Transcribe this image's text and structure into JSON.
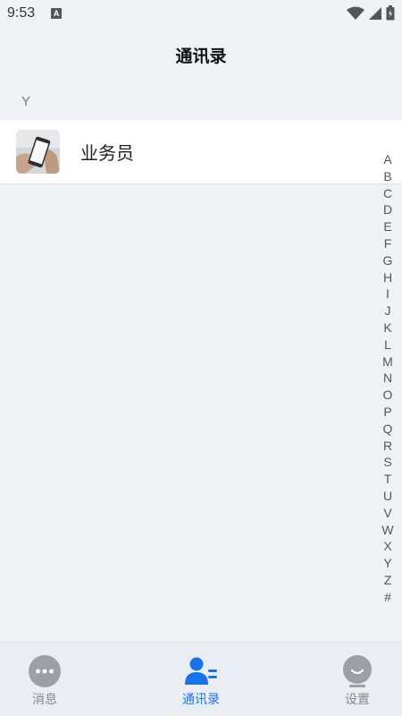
{
  "status_bar": {
    "time": "9:53",
    "notification_badge": "A"
  },
  "header": {
    "title": "通讯录"
  },
  "contacts": {
    "section_letter": "Y",
    "items": [
      {
        "name": "业务员",
        "avatar_icon": "phone-in-hand-photo"
      }
    ]
  },
  "index_letters": [
    "A",
    "B",
    "C",
    "D",
    "E",
    "F",
    "G",
    "H",
    "I",
    "J",
    "K",
    "L",
    "M",
    "N",
    "O",
    "P",
    "Q",
    "R",
    "S",
    "T",
    "U",
    "V",
    "W",
    "X",
    "Y",
    "Z",
    "#"
  ],
  "tabs": [
    {
      "label": "消息",
      "icon": "chat-bubble-icon",
      "active": false
    },
    {
      "label": "通讯录",
      "icon": "contacts-icon",
      "active": true
    },
    {
      "label": "设置",
      "icon": "settings-face-icon",
      "active": false
    }
  ],
  "colors": {
    "background": "#eef2f7",
    "accent": "#1a73e8",
    "inactive_icon": "#9aa0a6"
  }
}
